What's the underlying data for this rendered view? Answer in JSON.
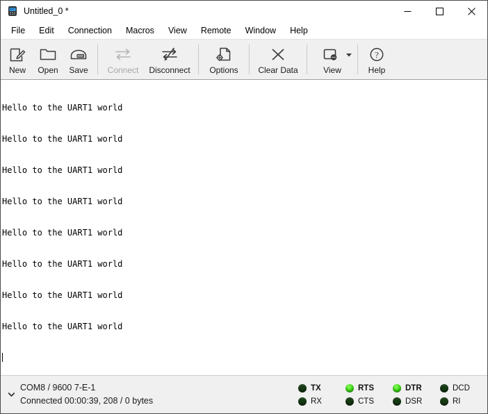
{
  "window": {
    "title": "Untitled_0 *",
    "icon": "terminal-device-icon",
    "controls": {
      "minimize": "minimize-icon",
      "maximize": "maximize-icon",
      "close": "close-icon"
    }
  },
  "menu": {
    "items": [
      {
        "label": "File"
      },
      {
        "label": "Edit"
      },
      {
        "label": "Connection"
      },
      {
        "label": "Macros"
      },
      {
        "label": "View"
      },
      {
        "label": "Remote"
      },
      {
        "label": "Window"
      },
      {
        "label": "Help"
      }
    ]
  },
  "toolbar": {
    "buttons": [
      {
        "label": "New",
        "icon": "new-document-icon",
        "disabled": false
      },
      {
        "label": "Open",
        "icon": "open-folder-icon",
        "disabled": false
      },
      {
        "label": "Save",
        "icon": "save-disk-icon",
        "disabled": false
      },
      {
        "label": "Connect",
        "icon": "connect-arrows-icon",
        "disabled": true
      },
      {
        "label": "Disconnect",
        "icon": "disconnect-arrows-icon",
        "disabled": false
      },
      {
        "label": "Options",
        "icon": "options-gear-document-icon",
        "disabled": false
      },
      {
        "label": "Clear Data",
        "icon": "clear-x-icon",
        "disabled": false
      },
      {
        "label": "View",
        "icon": "view-window-icon",
        "disabled": false,
        "has_dropdown": true
      },
      {
        "label": "Help",
        "icon": "help-question-icon",
        "disabled": false
      }
    ]
  },
  "terminal": {
    "lines": [
      "Hello to the UART1 world",
      "Hello to the UART1 world",
      "Hello to the UART1 world",
      "Hello to the UART1 world",
      "Hello to the UART1 world",
      "Hello to the UART1 world",
      "Hello to the UART1 world",
      "Hello to the UART1 world"
    ],
    "cursor_visible": true,
    "background_color": "#ffffff",
    "text_color": "#000000"
  },
  "statusbar": {
    "expander_icon": "chevron-down-icon",
    "connection_settings": "COM8 / 9600 7-E-1",
    "connection_status": "Connected 00:00:39, 208 / 0 bytes",
    "led_on_color": "#45e01e",
    "led_off_color": "#153a12",
    "signals": [
      {
        "label": "TX",
        "on": false,
        "bold": true
      },
      {
        "label": "RX",
        "on": false,
        "bold": false
      },
      {
        "label": "RTS",
        "on": true,
        "bold": true
      },
      {
        "label": "CTS",
        "on": false,
        "bold": false
      },
      {
        "label": "DTR",
        "on": true,
        "bold": true
      },
      {
        "label": "DSR",
        "on": false,
        "bold": false
      },
      {
        "label": "DCD",
        "on": false,
        "bold": false
      },
      {
        "label": "RI",
        "on": false,
        "bold": false
      }
    ]
  }
}
